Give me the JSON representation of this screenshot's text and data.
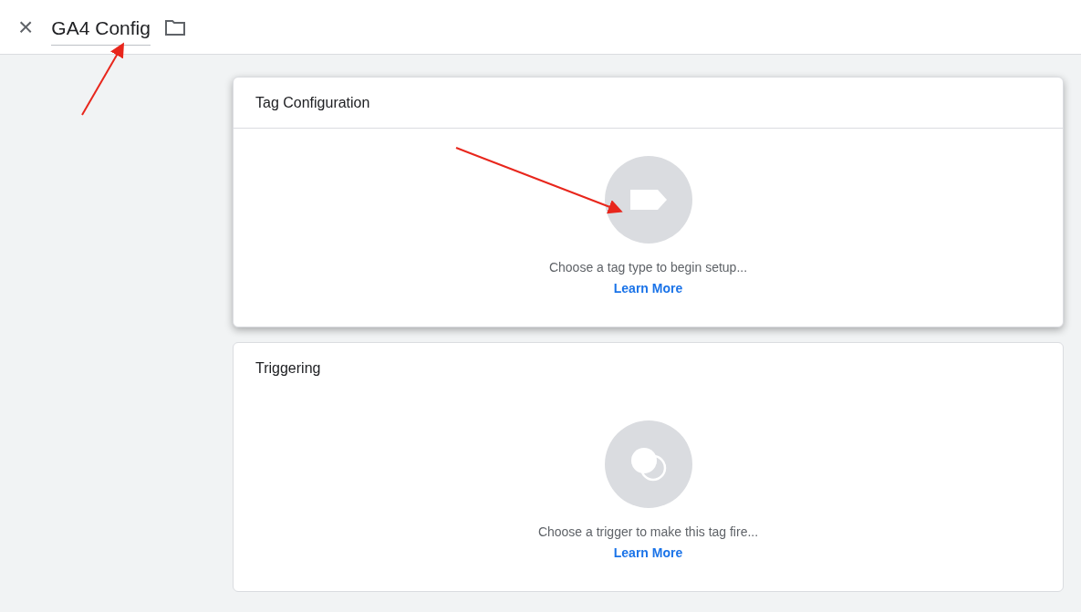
{
  "header": {
    "close": "×",
    "title": "GA4 Config"
  },
  "cards": [
    {
      "kind": "tag",
      "title": "Tag Configuration",
      "prompt": "Choose a tag type to begin setup...",
      "link": "Learn More",
      "raised": true
    },
    {
      "kind": "trigger",
      "title": "Triggering",
      "prompt": "Choose a trigger to make this tag fire...",
      "link": "Learn More",
      "raised": false
    }
  ]
}
